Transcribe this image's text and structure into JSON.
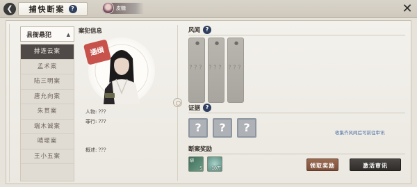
{
  "header": {
    "back_icon": "back-arrow-icon",
    "title": "捕快断案",
    "help_icon": "question-icon",
    "player_name": "皮糖",
    "close_icon": "close-icon"
  },
  "case_list": {
    "filter_label": "县衙悬犯",
    "items": [
      "赫连云案",
      "孟术案",
      "陆三明案",
      "唐允向案",
      "朱贯案",
      "端木诚案",
      "晴堤案",
      "王小五案"
    ],
    "active_index": 0
  },
  "case_info": {
    "section_title": "案犯信息",
    "stamp_text": "通缉",
    "person_label": "人物:",
    "person_value": "???",
    "crime_label": "罪行:",
    "crime_value": "???",
    "summary_label": "概述:",
    "summary_value": "???"
  },
  "rumors": {
    "section_title": "风闻",
    "cards": [
      {
        "text": "？？？",
        "lock_icon": "lock-icon"
      },
      {
        "text": "？？？",
        "lock_icon": "lock-icon"
      },
      {
        "text": "？？？",
        "lock_icon": "lock-icon"
      }
    ]
  },
  "evidence": {
    "section_title": "证据",
    "cards": [
      "?",
      "?",
      "?"
    ]
  },
  "rewards": {
    "section_title": "断案奖励",
    "items": [
      {
        "icon": "scroll-item-icon",
        "count": "5",
        "color": "#3d6b57",
        "tag": "绑"
      },
      {
        "icon": "jade-item-icon",
        "count": "10万",
        "color": "#5e8f86"
      }
    ],
    "hint": "收集齐风闻后可前往审讯",
    "claim_label": "领取奖励",
    "activate_label": "激活审讯"
  }
}
